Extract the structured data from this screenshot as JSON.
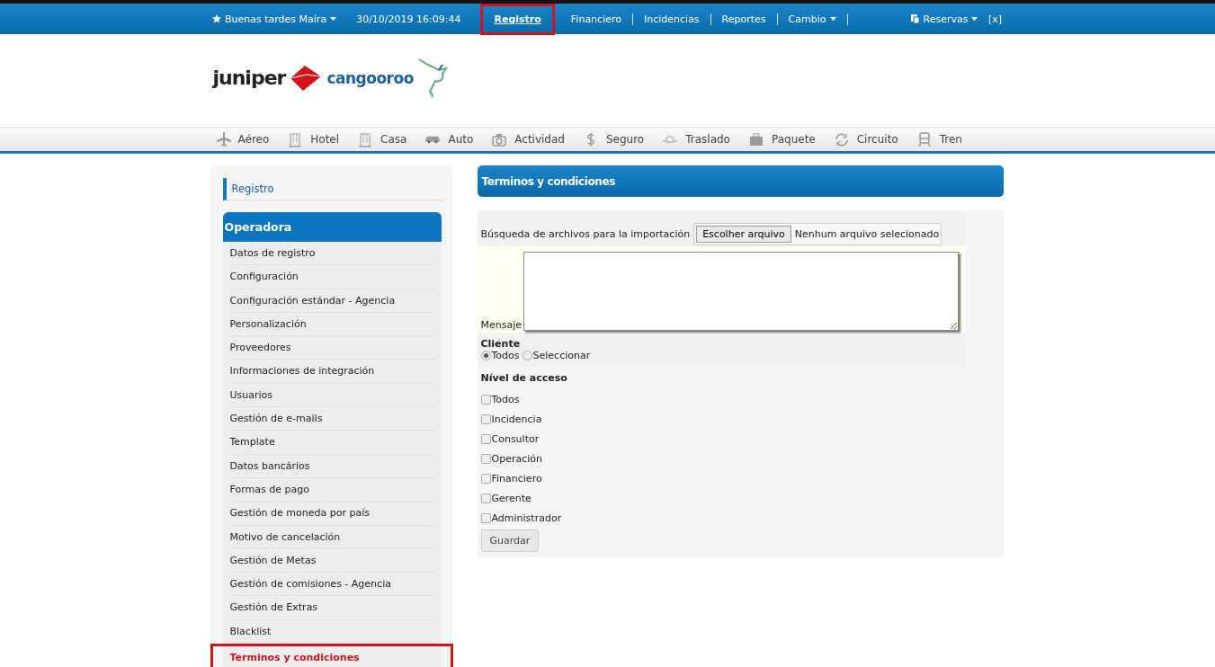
{
  "top_bar": {
    "greeting": "Buenas tardes Maíra",
    "datetime": "30/10/2019 16:09:44",
    "nav": [
      {
        "label": "Registro",
        "selected": true,
        "highlighted": true,
        "dropdown": false
      },
      {
        "label": "Financiero",
        "selected": false,
        "highlighted": false,
        "dropdown": false
      },
      {
        "label": "Incidencias",
        "selected": false,
        "highlighted": false,
        "dropdown": false
      },
      {
        "label": "Reportes",
        "selected": false,
        "highlighted": false,
        "dropdown": false
      },
      {
        "label": "Cambio",
        "selected": false,
        "highlighted": false,
        "dropdown": true
      }
    ],
    "reservations": "Reservas",
    "close": "[x]"
  },
  "logo": {
    "brand": "juniper",
    "partner": "cangooroo"
  },
  "services": [
    {
      "label": "Aéreo",
      "kind": "plane"
    },
    {
      "label": "Hotel",
      "kind": "building"
    },
    {
      "label": "Casa",
      "kind": "building"
    },
    {
      "label": "Auto",
      "kind": "car"
    },
    {
      "label": "Actividad",
      "kind": "camera"
    },
    {
      "label": "Seguro",
      "kind": "dollar"
    },
    {
      "label": "Traslado",
      "kind": "transfer"
    },
    {
      "label": "Paquete",
      "kind": "briefcase"
    },
    {
      "label": "Circuito",
      "kind": "circuit"
    },
    {
      "label": "Tren",
      "kind": "train"
    }
  ],
  "sidebar": {
    "section": "Registro",
    "group": "Operadora",
    "items": [
      {
        "label": "Datos de registro",
        "selected": false,
        "highlighted": false
      },
      {
        "label": "Configuración",
        "selected": false,
        "highlighted": false
      },
      {
        "label": "Configuración estándar - Agencia",
        "selected": false,
        "highlighted": false
      },
      {
        "label": "Personalización",
        "selected": false,
        "highlighted": false
      },
      {
        "label": "Proveedores",
        "selected": false,
        "highlighted": false
      },
      {
        "label": "Informaciones de integración",
        "selected": false,
        "highlighted": false
      },
      {
        "label": "Usuarios",
        "selected": false,
        "highlighted": false
      },
      {
        "label": "Gestión de e-mails",
        "selected": false,
        "highlighted": false
      },
      {
        "label": "Template",
        "selected": false,
        "highlighted": false
      },
      {
        "label": "Datos bancários",
        "selected": false,
        "highlighted": false
      },
      {
        "label": "Formas de pago",
        "selected": false,
        "highlighted": false
      },
      {
        "label": "Gestión de moneda por país",
        "selected": false,
        "highlighted": false
      },
      {
        "label": "Motivo de cancelación",
        "selected": false,
        "highlighted": false
      },
      {
        "label": "Gestión de Metas",
        "selected": false,
        "highlighted": false
      },
      {
        "label": "Gestión de comisiones - Agencia",
        "selected": false,
        "highlighted": false
      },
      {
        "label": "Gestión de Extras",
        "selected": false,
        "highlighted": false
      },
      {
        "label": "Blacklist",
        "selected": false,
        "highlighted": false
      },
      {
        "label": "Terminos y condiciones",
        "selected": true,
        "highlighted": true
      }
    ]
  },
  "main": {
    "title": "Terminos y condiciones",
    "file": {
      "label": "Búsqueda de archivos para la importación",
      "button": "Escolher arquivo",
      "status": "Nenhum arquivo selecionado"
    },
    "message_label": "Mensaje",
    "client": {
      "label": "Cliente",
      "options": [
        {
          "label": "Todos",
          "selected": true
        },
        {
          "label": "Seleccionar",
          "selected": false
        }
      ]
    },
    "access": {
      "label": "Nível de acceso",
      "options": [
        {
          "label": "Todos",
          "checked": false
        },
        {
          "label": "Incidencia",
          "checked": false
        },
        {
          "label": "Consultor",
          "checked": false
        },
        {
          "label": "Operación",
          "checked": false
        },
        {
          "label": "Financiero",
          "checked": false
        },
        {
          "label": "Gerente",
          "checked": false
        },
        {
          "label": "Administrador",
          "checked": false
        }
      ]
    },
    "save": "Guardar"
  }
}
